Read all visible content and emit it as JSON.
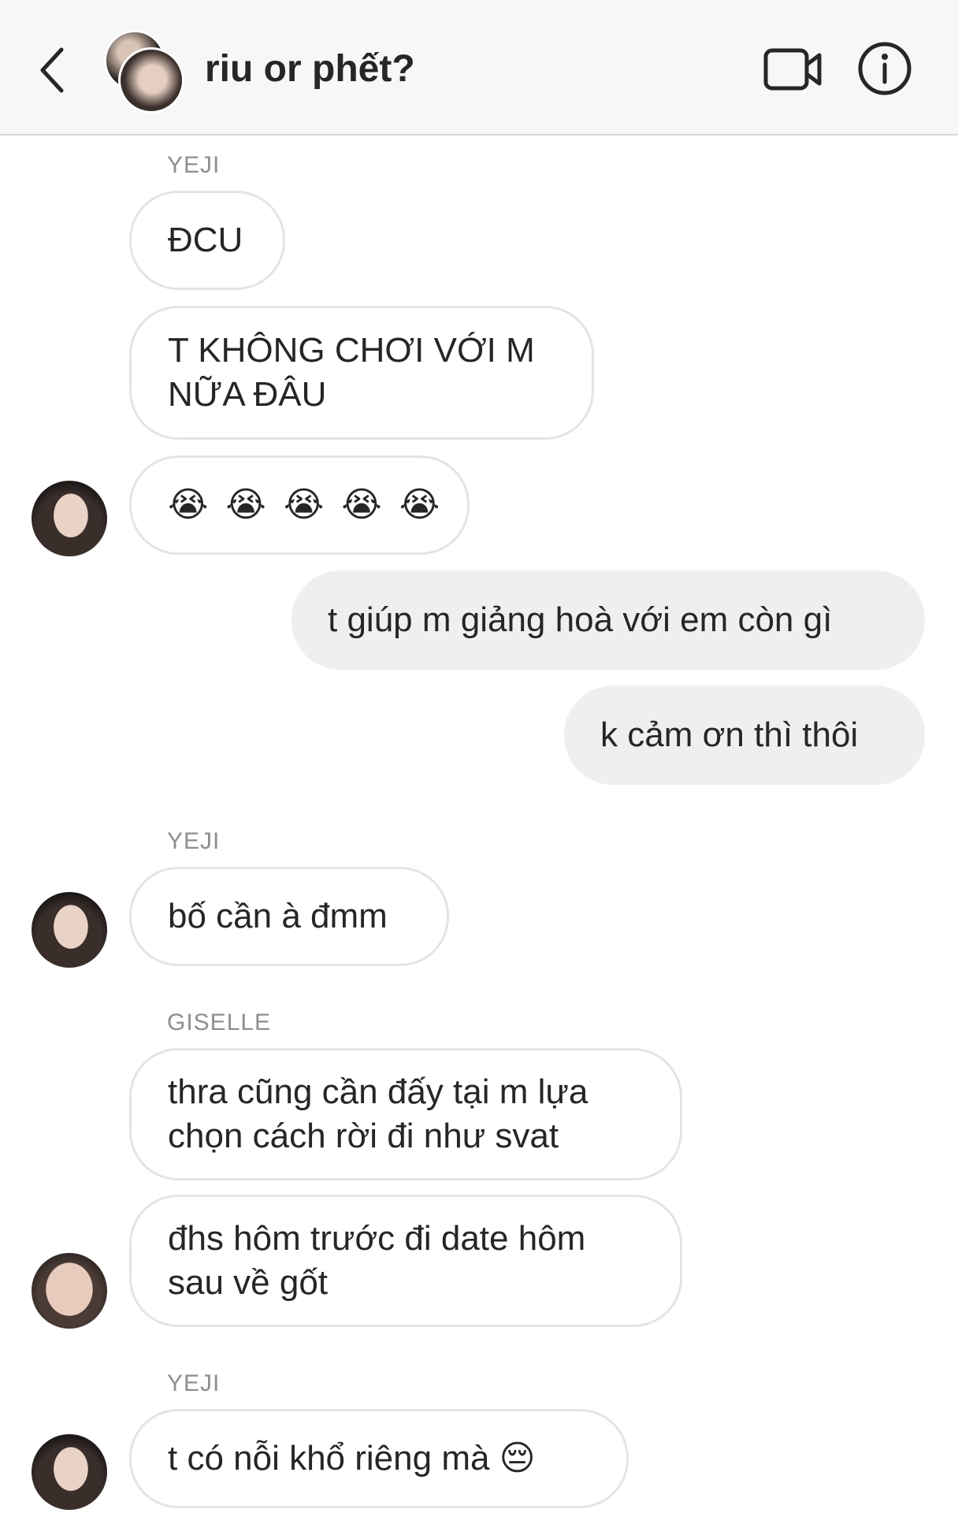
{
  "header": {
    "title": "riu or phết?",
    "back_icon": "chevron-left-icon",
    "video_icon": "video-camera-icon",
    "info_icon": "info-icon"
  },
  "messages": [
    {
      "sender": "YEJI"
    },
    {
      "text": "ĐCU"
    },
    {
      "text": "T KHÔNG CHƠI VỚI M NỮA ĐÂU"
    },
    {
      "text": "😭😭😭😭😭"
    },
    {
      "text": "t giúp m giảng hoà với em còn gì"
    },
    {
      "text": "k cảm ơn thì thôi"
    },
    {
      "sender": "YEJI"
    },
    {
      "text": "bố cần à đmm"
    },
    {
      "sender": "GISELLE"
    },
    {
      "text": "thra cũng cần đấy tại m lựa chọn cách rời đi như svat"
    },
    {
      "text": "đhs hôm trước đi date hôm sau về gốt"
    },
    {
      "sender": "YEJI"
    },
    {
      "text": "t có nỗi khổ riêng mà 😔"
    }
  ],
  "emoji": [
    "😭",
    "😭",
    "😭",
    "😭",
    "😭"
  ],
  "colors": {
    "header_bg": "#f7f7f7",
    "incoming_border": "#e4e4e4",
    "outgoing_bg": "#efefef",
    "sender_label": "#8e8e8e",
    "text": "#262626"
  }
}
